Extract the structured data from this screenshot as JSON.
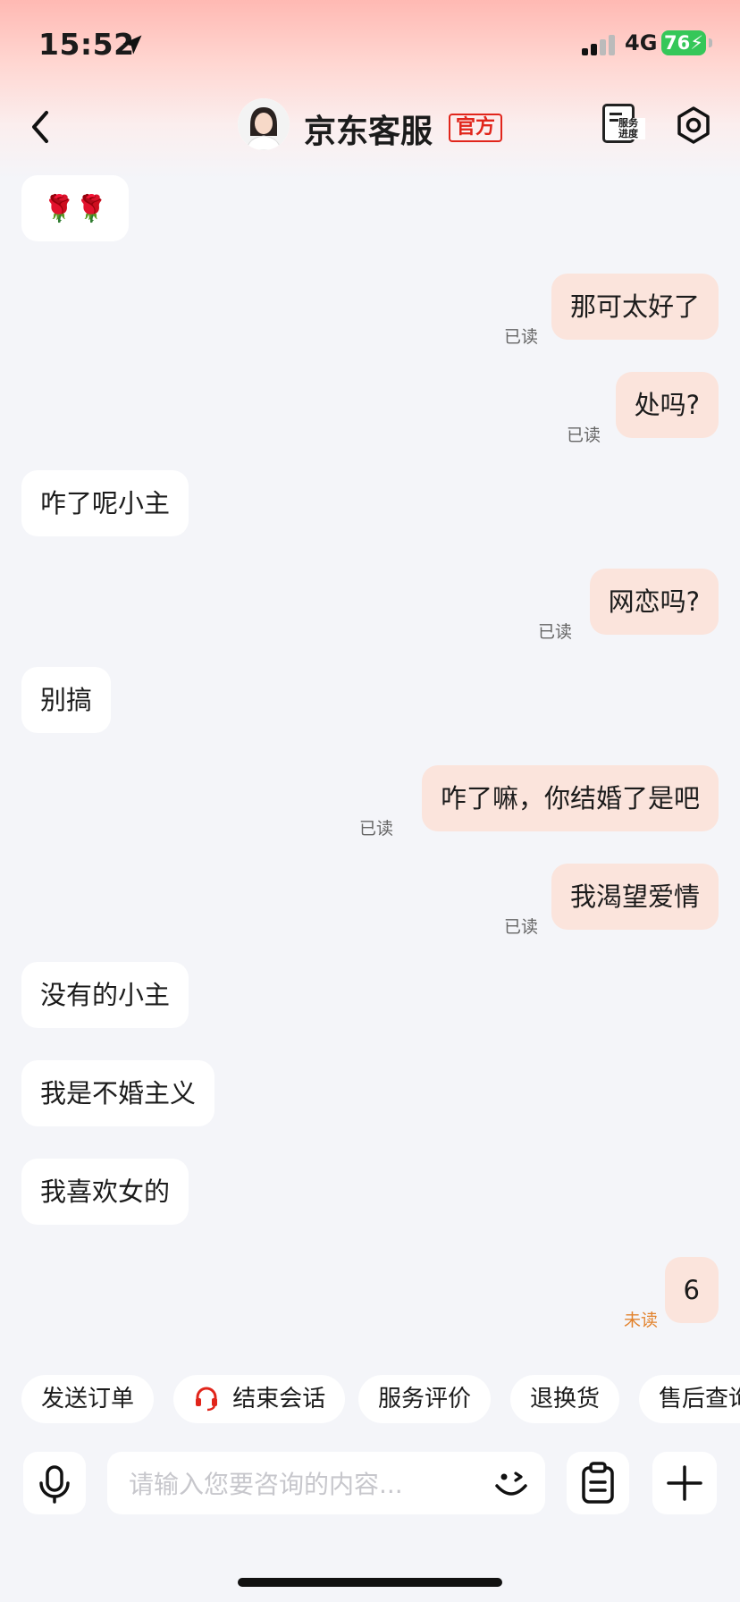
{
  "status": {
    "time": "15:52",
    "network": "4G",
    "battery": "76"
  },
  "header": {
    "title": "京东客服",
    "badge": "官方",
    "progress_label": "服务进度"
  },
  "messages": [
    {
      "side": "left",
      "text": "🌹🌹"
    },
    {
      "side": "right",
      "text": "那可太好了",
      "status": "已读"
    },
    {
      "side": "right",
      "text": "处吗?",
      "status": "已读"
    },
    {
      "side": "left",
      "text": "咋了呢小主"
    },
    {
      "side": "right",
      "text": "网恋吗?",
      "status": "已读"
    },
    {
      "side": "left",
      "text": "别搞"
    },
    {
      "side": "right",
      "text": "咋了嘛，你结婚了是吧",
      "status": "已读"
    },
    {
      "side": "right",
      "text": "我渴望爱情",
      "status": "已读"
    },
    {
      "side": "left",
      "text": "没有的小主"
    },
    {
      "side": "left",
      "text": "我是不婚主义"
    },
    {
      "side": "left",
      "text": "我喜欢女的"
    },
    {
      "side": "right",
      "text": "6",
      "status": "未读"
    }
  ],
  "quick_actions": [
    {
      "label": "发送订单"
    },
    {
      "label": "结束会话",
      "icon": "headset-icon"
    },
    {
      "label": "服务评价"
    },
    {
      "label": "退换货"
    },
    {
      "label": "售后查询"
    }
  ],
  "input": {
    "placeholder": "请输入您要咨询的内容..."
  },
  "colors": {
    "brand_red": "#e1251b",
    "outgoing_bubble": "#fbe4dc",
    "incoming_bubble": "#ffffff",
    "unread": "#e2832e",
    "battery": "#35c759"
  }
}
